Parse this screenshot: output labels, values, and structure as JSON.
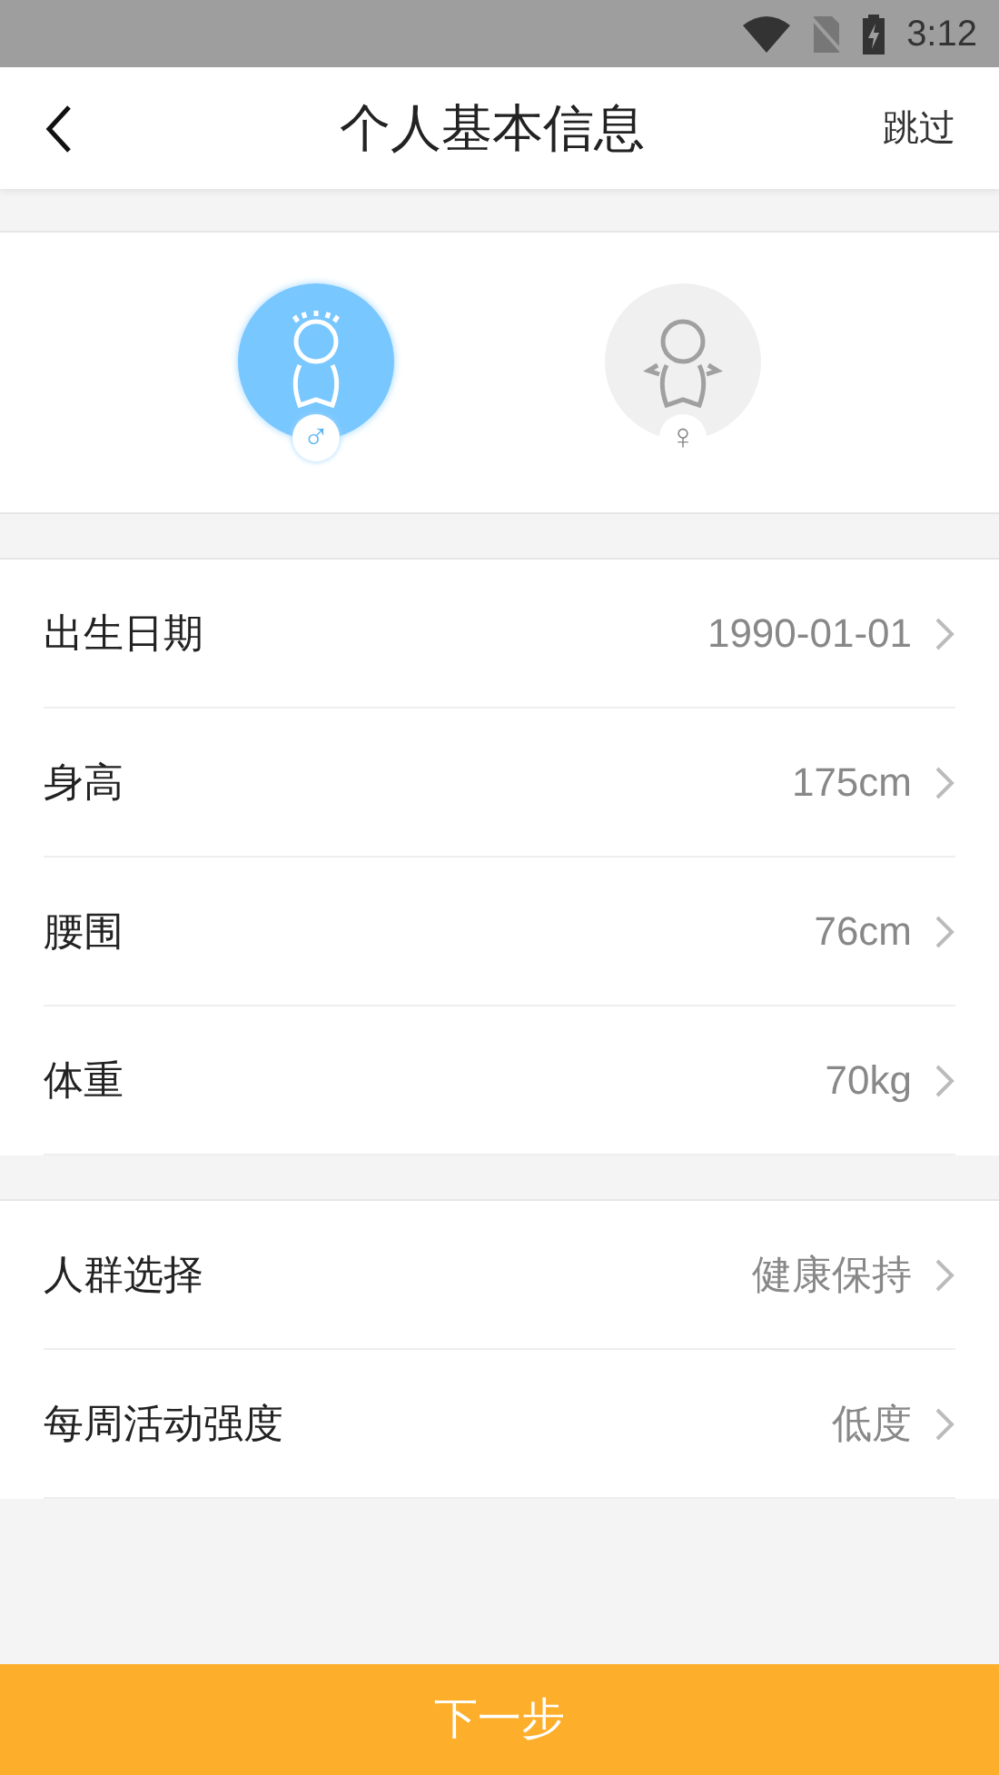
{
  "status_bar": {
    "time": "3:12"
  },
  "header": {
    "title": "个人基本信息",
    "skip": "跳过"
  },
  "genders": [
    {
      "kind": "male",
      "symbol": "♂",
      "selected": true
    },
    {
      "kind": "female",
      "symbol": "♀",
      "selected": false
    }
  ],
  "groups": [
    {
      "rows": [
        {
          "label": "出生日期",
          "value": "1990-01-01"
        },
        {
          "label": "身高",
          "value": "175cm"
        },
        {
          "label": "腰围",
          "value": "76cm"
        },
        {
          "label": "体重",
          "value": "70kg"
        }
      ]
    },
    {
      "rows": [
        {
          "label": "人群选择",
          "value": "健康保持"
        },
        {
          "label": "每周活动强度",
          "value": "低度"
        }
      ]
    }
  ],
  "next_button": "下一步"
}
